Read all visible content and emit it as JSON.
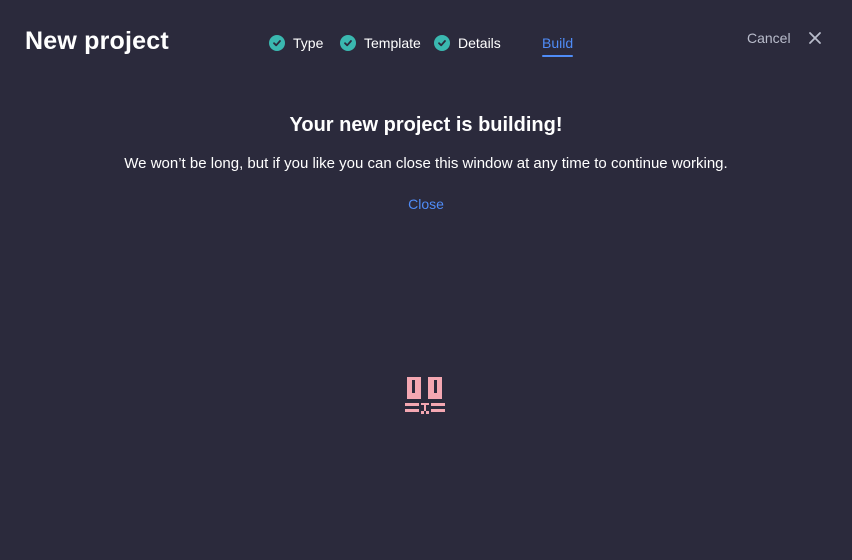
{
  "header": {
    "title": "New project",
    "steps": [
      {
        "label": "Type",
        "icon": "check-circle-icon",
        "status": "complete"
      },
      {
        "label": "Template",
        "icon": "check-circle-icon",
        "status": "complete"
      },
      {
        "label": "Details",
        "icon": "check-circle-icon",
        "status": "complete"
      },
      {
        "label": "Build",
        "status": "active"
      }
    ],
    "cancel_label": "Cancel",
    "close_icon": "close-icon"
  },
  "content": {
    "heading": "Your new project is building!",
    "message": "We won’t be long, but if you like you can close this window at any time to continue working.",
    "close_label": "Close",
    "loader_icon": "building-animation-icon"
  },
  "colors": {
    "background": "#2b2a3c",
    "accent": "#4f8cf7",
    "check": "#3ab8b0",
    "loader": "#f4a7b2",
    "muted_text": "#b9bccb"
  }
}
